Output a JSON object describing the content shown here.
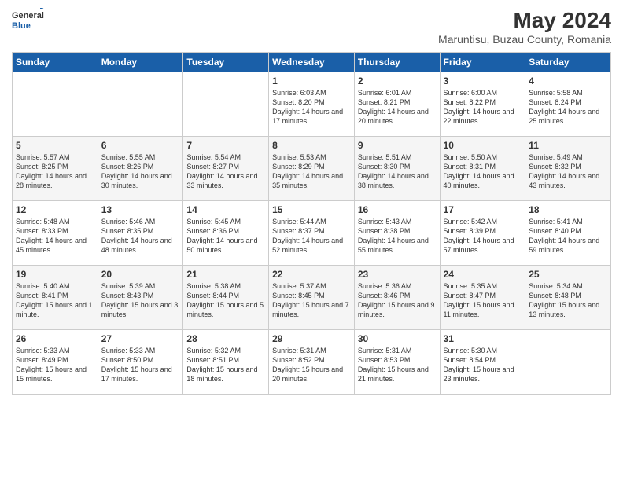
{
  "header": {
    "logo_general": "General",
    "logo_blue": "Blue",
    "title": "May 2024",
    "subtitle": "Maruntisu, Buzau County, Romania"
  },
  "days_of_week": [
    "Sunday",
    "Monday",
    "Tuesday",
    "Wednesday",
    "Thursday",
    "Friday",
    "Saturday"
  ],
  "weeks": [
    [
      {
        "day": "",
        "sunrise": "",
        "sunset": "",
        "daylight": ""
      },
      {
        "day": "",
        "sunrise": "",
        "sunset": "",
        "daylight": ""
      },
      {
        "day": "",
        "sunrise": "",
        "sunset": "",
        "daylight": ""
      },
      {
        "day": "1",
        "sunrise": "Sunrise: 6:03 AM",
        "sunset": "Sunset: 8:20 PM",
        "daylight": "Daylight: 14 hours and 17 minutes."
      },
      {
        "day": "2",
        "sunrise": "Sunrise: 6:01 AM",
        "sunset": "Sunset: 8:21 PM",
        "daylight": "Daylight: 14 hours and 20 minutes."
      },
      {
        "day": "3",
        "sunrise": "Sunrise: 6:00 AM",
        "sunset": "Sunset: 8:22 PM",
        "daylight": "Daylight: 14 hours and 22 minutes."
      },
      {
        "day": "4",
        "sunrise": "Sunrise: 5:58 AM",
        "sunset": "Sunset: 8:24 PM",
        "daylight": "Daylight: 14 hours and 25 minutes."
      }
    ],
    [
      {
        "day": "5",
        "sunrise": "Sunrise: 5:57 AM",
        "sunset": "Sunset: 8:25 PM",
        "daylight": "Daylight: 14 hours and 28 minutes."
      },
      {
        "day": "6",
        "sunrise": "Sunrise: 5:55 AM",
        "sunset": "Sunset: 8:26 PM",
        "daylight": "Daylight: 14 hours and 30 minutes."
      },
      {
        "day": "7",
        "sunrise": "Sunrise: 5:54 AM",
        "sunset": "Sunset: 8:27 PM",
        "daylight": "Daylight: 14 hours and 33 minutes."
      },
      {
        "day": "8",
        "sunrise": "Sunrise: 5:53 AM",
        "sunset": "Sunset: 8:29 PM",
        "daylight": "Daylight: 14 hours and 35 minutes."
      },
      {
        "day": "9",
        "sunrise": "Sunrise: 5:51 AM",
        "sunset": "Sunset: 8:30 PM",
        "daylight": "Daylight: 14 hours and 38 minutes."
      },
      {
        "day": "10",
        "sunrise": "Sunrise: 5:50 AM",
        "sunset": "Sunset: 8:31 PM",
        "daylight": "Daylight: 14 hours and 40 minutes."
      },
      {
        "day": "11",
        "sunrise": "Sunrise: 5:49 AM",
        "sunset": "Sunset: 8:32 PM",
        "daylight": "Daylight: 14 hours and 43 minutes."
      }
    ],
    [
      {
        "day": "12",
        "sunrise": "Sunrise: 5:48 AM",
        "sunset": "Sunset: 8:33 PM",
        "daylight": "Daylight: 14 hours and 45 minutes."
      },
      {
        "day": "13",
        "sunrise": "Sunrise: 5:46 AM",
        "sunset": "Sunset: 8:35 PM",
        "daylight": "Daylight: 14 hours and 48 minutes."
      },
      {
        "day": "14",
        "sunrise": "Sunrise: 5:45 AM",
        "sunset": "Sunset: 8:36 PM",
        "daylight": "Daylight: 14 hours and 50 minutes."
      },
      {
        "day": "15",
        "sunrise": "Sunrise: 5:44 AM",
        "sunset": "Sunset: 8:37 PM",
        "daylight": "Daylight: 14 hours and 52 minutes."
      },
      {
        "day": "16",
        "sunrise": "Sunrise: 5:43 AM",
        "sunset": "Sunset: 8:38 PM",
        "daylight": "Daylight: 14 hours and 55 minutes."
      },
      {
        "day": "17",
        "sunrise": "Sunrise: 5:42 AM",
        "sunset": "Sunset: 8:39 PM",
        "daylight": "Daylight: 14 hours and 57 minutes."
      },
      {
        "day": "18",
        "sunrise": "Sunrise: 5:41 AM",
        "sunset": "Sunset: 8:40 PM",
        "daylight": "Daylight: 14 hours and 59 minutes."
      }
    ],
    [
      {
        "day": "19",
        "sunrise": "Sunrise: 5:40 AM",
        "sunset": "Sunset: 8:41 PM",
        "daylight": "Daylight: 15 hours and 1 minute."
      },
      {
        "day": "20",
        "sunrise": "Sunrise: 5:39 AM",
        "sunset": "Sunset: 8:43 PM",
        "daylight": "Daylight: 15 hours and 3 minutes."
      },
      {
        "day": "21",
        "sunrise": "Sunrise: 5:38 AM",
        "sunset": "Sunset: 8:44 PM",
        "daylight": "Daylight: 15 hours and 5 minutes."
      },
      {
        "day": "22",
        "sunrise": "Sunrise: 5:37 AM",
        "sunset": "Sunset: 8:45 PM",
        "daylight": "Daylight: 15 hours and 7 minutes."
      },
      {
        "day": "23",
        "sunrise": "Sunrise: 5:36 AM",
        "sunset": "Sunset: 8:46 PM",
        "daylight": "Daylight: 15 hours and 9 minutes."
      },
      {
        "day": "24",
        "sunrise": "Sunrise: 5:35 AM",
        "sunset": "Sunset: 8:47 PM",
        "daylight": "Daylight: 15 hours and 11 minutes."
      },
      {
        "day": "25",
        "sunrise": "Sunrise: 5:34 AM",
        "sunset": "Sunset: 8:48 PM",
        "daylight": "Daylight: 15 hours and 13 minutes."
      }
    ],
    [
      {
        "day": "26",
        "sunrise": "Sunrise: 5:33 AM",
        "sunset": "Sunset: 8:49 PM",
        "daylight": "Daylight: 15 hours and 15 minutes."
      },
      {
        "day": "27",
        "sunrise": "Sunrise: 5:33 AM",
        "sunset": "Sunset: 8:50 PM",
        "daylight": "Daylight: 15 hours and 17 minutes."
      },
      {
        "day": "28",
        "sunrise": "Sunrise: 5:32 AM",
        "sunset": "Sunset: 8:51 PM",
        "daylight": "Daylight: 15 hours and 18 minutes."
      },
      {
        "day": "29",
        "sunrise": "Sunrise: 5:31 AM",
        "sunset": "Sunset: 8:52 PM",
        "daylight": "Daylight: 15 hours and 20 minutes."
      },
      {
        "day": "30",
        "sunrise": "Sunrise: 5:31 AM",
        "sunset": "Sunset: 8:53 PM",
        "daylight": "Daylight: 15 hours and 21 minutes."
      },
      {
        "day": "31",
        "sunrise": "Sunrise: 5:30 AM",
        "sunset": "Sunset: 8:54 PM",
        "daylight": "Daylight: 15 hours and 23 minutes."
      },
      {
        "day": "",
        "sunrise": "",
        "sunset": "",
        "daylight": ""
      }
    ]
  ]
}
